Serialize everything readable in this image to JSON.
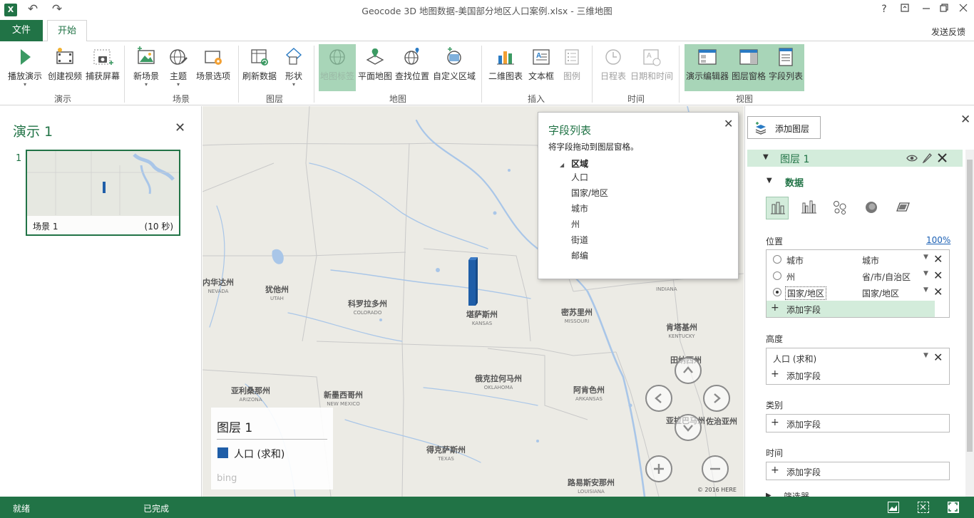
{
  "titlebar": {
    "app_icon": "X",
    "title": "Geocode 3D 地图数据-美国部分地区人口案例.xlsx - 三维地图",
    "help": "?",
    "undo_icon": "↶",
    "redo_icon": "↷"
  },
  "tabs": {
    "file": "文件",
    "home": "开始",
    "feedback": "发送反馈"
  },
  "ribbon": {
    "buttons": {
      "play_tour": "播放演示",
      "create_video": "创建视频",
      "capture_screen": "捕获屏幕",
      "new_scene": "新场景",
      "theme": "主题",
      "scene_options": "场景选项",
      "refresh_data": "刷新数据",
      "shapes": "形状",
      "map_labels": "地图标签",
      "flat_map": "平面地图",
      "find_location": "查找位置",
      "custom_regions": "自定义区域",
      "chart_2d": "二维图表",
      "text_box": "文本框",
      "legend": "图例",
      "timeline": "日程表",
      "date_time": "日期和时间",
      "tour_editor": "演示编辑器",
      "layer_pane": "图层窗格",
      "field_list": "字段列表"
    },
    "groups": {
      "tour": "演示",
      "scene": "场景",
      "layer": "图层",
      "map": "地图",
      "insert": "插入",
      "time": "时间",
      "view": "视图"
    }
  },
  "tour": {
    "title": "演示 1",
    "close": "✕",
    "scene_number": "1",
    "scene_name": "场景 1",
    "scene_duration": "(10 秒)"
  },
  "map": {
    "labels": [
      {
        "cn": "犹他州",
        "en": "UTAH"
      },
      {
        "cn": "科罗拉多州",
        "en": "COLORADO"
      },
      {
        "cn": "堪萨斯州",
        "en": "KANSAS"
      },
      {
        "cn": "密苏里州",
        "en": "MISSOURI"
      },
      {
        "cn": "新墨西哥州",
        "en": "NEW MEXICO"
      },
      {
        "cn": "俄克拉何马州",
        "en": "OKLAHOMA"
      },
      {
        "cn": "阿肯色州",
        "en": "ARKANSAS"
      },
      {
        "cn": "得克萨斯州",
        "en": "TEXAS"
      },
      {
        "cn": "亚利桑那州",
        "en": "ARIZONA"
      },
      {
        "cn": "路易斯安那州",
        "en": "LOUISIANA"
      },
      {
        "cn": "肯塔基州",
        "en": "KENTUCKY"
      },
      {
        "cn": "内华达州",
        "en": "NEVADA"
      },
      {
        "cn": "田纳西州",
        "en": ""
      },
      {
        "cn": "亚拉巴马州",
        "en": ""
      },
      {
        "cn": "佐治亚州",
        "en": ""
      },
      {
        "cn": "",
        "en": "INDIANA"
      }
    ],
    "legend": {
      "title": "图层 1",
      "item": "人口 (求和)",
      "item_color": "#1f5ea8"
    },
    "bing": "bing",
    "copyright": "© 2016 HERE",
    "nav": {
      "up": "⌃",
      "down": "⌄",
      "left": "‹",
      "right": "›",
      "zoom_in": "+",
      "zoom_out": "−"
    }
  },
  "field_list": {
    "title": "字段列表",
    "close": "✕",
    "hint": "将字段拖动到图层窗格。",
    "group": "区域",
    "fields": [
      "人口",
      "国家/地区",
      "城市",
      "州",
      "街道",
      "邮编"
    ]
  },
  "layer_pane": {
    "close": "✕",
    "add_layer": "添加图层",
    "layer_name": "图层 1",
    "data_header": "数据",
    "location_label": "位置",
    "location_pct": "100%",
    "location_fields": [
      {
        "name": "城市",
        "mapping": "城市",
        "selected": false
      },
      {
        "name": "州",
        "mapping": "省/市/自治区",
        "selected": false
      },
      {
        "name": "国家/地区",
        "mapping": "国家/地区",
        "selected": true
      }
    ],
    "add_field": "添加字段",
    "height_label": "高度",
    "height_field": "人口 (求和)",
    "category_label": "类别",
    "time_label": "时间",
    "filter_label": "筛选器"
  },
  "status": {
    "ready": "就绪",
    "done": "已完成"
  },
  "colors": {
    "accent": "#217346",
    "selected_ribbon": "#a8d5b8",
    "layer_header": "#d3ecdb",
    "bar": "#1f5ea8"
  }
}
